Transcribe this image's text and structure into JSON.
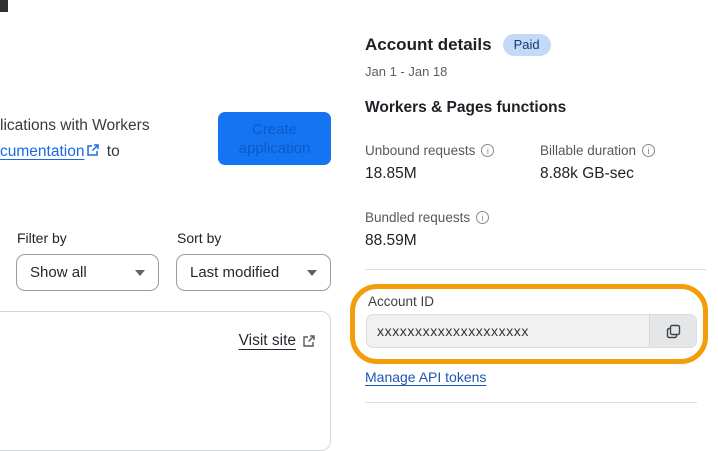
{
  "left": {
    "intro_line1": "lications with Workers",
    "intro_link_text": "cumentation",
    "intro_after_link": "to",
    "create_button": {
      "line1": "Create",
      "line2": "application"
    },
    "filter_label": "Filter by",
    "filter_value": "Show all",
    "sort_label": "Sort by",
    "sort_value": "Last modified",
    "visit_site_label": "Visit site"
  },
  "account_panel": {
    "title": "Account details",
    "badge": "Paid",
    "date_range": "Jan 1 - Jan 18",
    "section_title": "Workers & Pages functions",
    "stats": [
      {
        "label": "Unbound requests",
        "value": "18.85M"
      },
      {
        "label": "Billable duration",
        "value": "8.88k GB-sec"
      },
      {
        "label": "Bundled requests",
        "value": "88.59M"
      }
    ],
    "account_id_label": "Account ID",
    "account_id_value": "xxxxxxxxxxxxxxxxxxxx",
    "manage_link": "Manage API tokens"
  },
  "icons": {
    "external_link": "external-link",
    "copy": "copy",
    "info": "i",
    "chevron_down": "chevron-down"
  },
  "colors": {
    "accent_blue": "#1574f2",
    "link_blue": "#1a6be0",
    "manage_link_blue": "#1d55b4",
    "badge_bg": "#c4d9f8",
    "badge_text": "#163a6d",
    "highlight_orange": "#f49d0a"
  }
}
